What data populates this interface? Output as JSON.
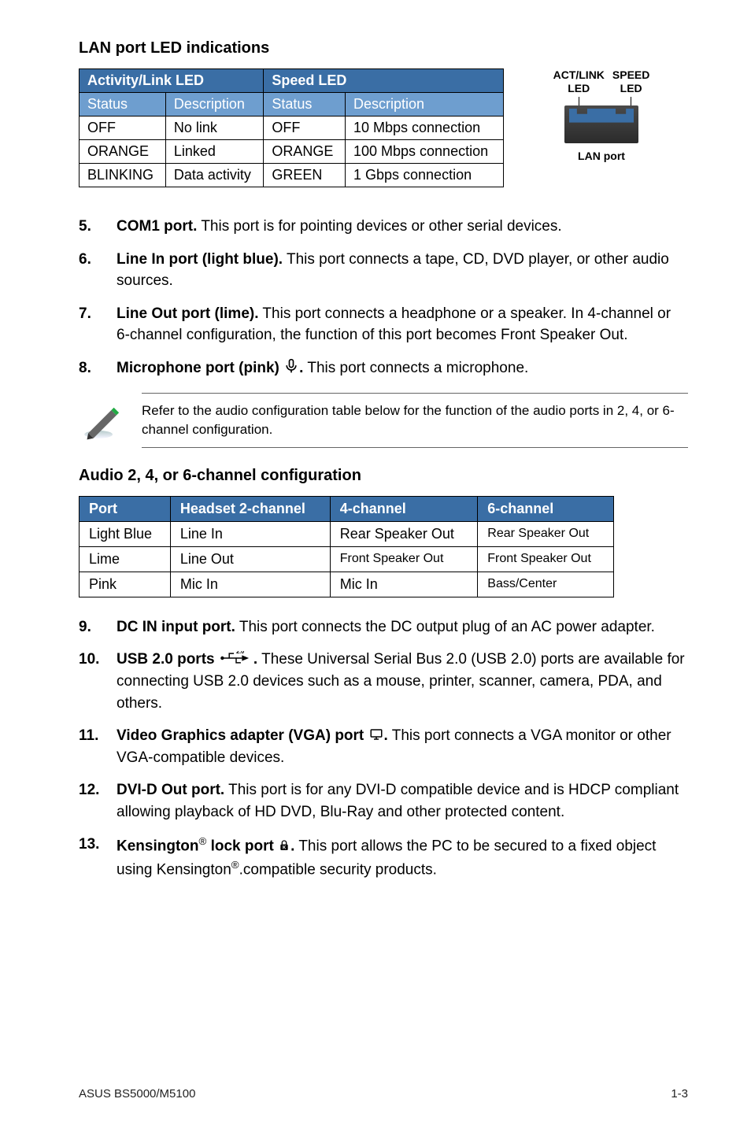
{
  "ledHeading": "LAN port LED indications",
  "ledTable": {
    "group1": "Activity/Link LED",
    "group2": "Speed LED",
    "sub": [
      "Status",
      "Description",
      "Status",
      "Description"
    ],
    "rows": [
      [
        "OFF",
        "No link",
        "OFF",
        "10 Mbps connection"
      ],
      [
        "ORANGE",
        "Linked",
        "ORANGE",
        "100 Mbps connection"
      ],
      [
        "BLINKING",
        "Data activity",
        "GREEN",
        "1 Gbps connection"
      ]
    ]
  },
  "diagram": {
    "left1": "ACT/LINK",
    "left2": "LED",
    "right1": "SPEED",
    "right2": "LED",
    "caption": "LAN port"
  },
  "items1": [
    {
      "n": "5.",
      "bold": "COM1 port.",
      "rest": " This port is for pointing devices or other serial devices."
    },
    {
      "n": "6.",
      "bold": "Line In port (light blue).",
      "rest": " This port connects a tape, CD, DVD player, or other audio sources."
    },
    {
      "n": "7.",
      "bold": "Line Out port (lime).",
      "rest": " This port connects a headphone or a speaker. In 4-channel or 6-channel configuration, the function of this port becomes Front Speaker Out."
    },
    {
      "n": "8.",
      "bold": "Microphone port (pink) ",
      "icon": "mic",
      "boldAfter": ".",
      "rest": " This port connects a microphone."
    }
  ],
  "note": "Refer to the audio configuration table below for the function of the audio ports in 2, 4, or 6-channel configuration.",
  "audioHeading": "Audio 2, 4, or 6-channel configuration",
  "audioTable": {
    "header": [
      "Port",
      "Headset 2-channel",
      "4-channel",
      "6-channel"
    ],
    "rows": [
      [
        "Light Blue",
        "Line In",
        "Rear Speaker Out",
        "Rear Speaker Out"
      ],
      [
        "Lime",
        "Line Out",
        "Front Speaker Out",
        "Front Speaker Out"
      ],
      [
        "Pink",
        "Mic In",
        "Mic In",
        "Bass/Center"
      ]
    ]
  },
  "items2": [
    {
      "n": "9.",
      "bold": "DC IN input port.",
      "rest": " This port connects the DC output plug of an AC power adapter."
    },
    {
      "n": "10.",
      "bold": "USB 2.0 ports ",
      "icon": "usb",
      "boldAfter": ".",
      "rest": " These Universal Serial Bus 2.0 (USB 2.0) ports are available for connecting USB 2.0 devices such as a mouse, printer, scanner, camera, PDA, and others."
    },
    {
      "n": "11.",
      "bold": "Video Graphics adapter (VGA) port ",
      "icon": "vga",
      "boldAfter": ".",
      "rest": " This port connects a VGA monitor or other VGA-compatible devices."
    },
    {
      "n": "12.",
      "bold": "DVI-D Out port.",
      "rest": " This port is for any DVI-D compatible device and is HDCP compliant allowing playback of HD DVD, Blu-Ray and other protected content."
    },
    {
      "n": "13.",
      "bold": "Kensington",
      "sup": "®",
      "bold2": " lock port ",
      "icon": "lock",
      "bold3": ".",
      "rest": " This port allows the PC to be secured to a fixed object using Kensington",
      "sup2": "®",
      "rest2": ".compatible security products."
    }
  ],
  "footer": {
    "left": "ASUS BS5000/M5100",
    "right": "1-3"
  }
}
